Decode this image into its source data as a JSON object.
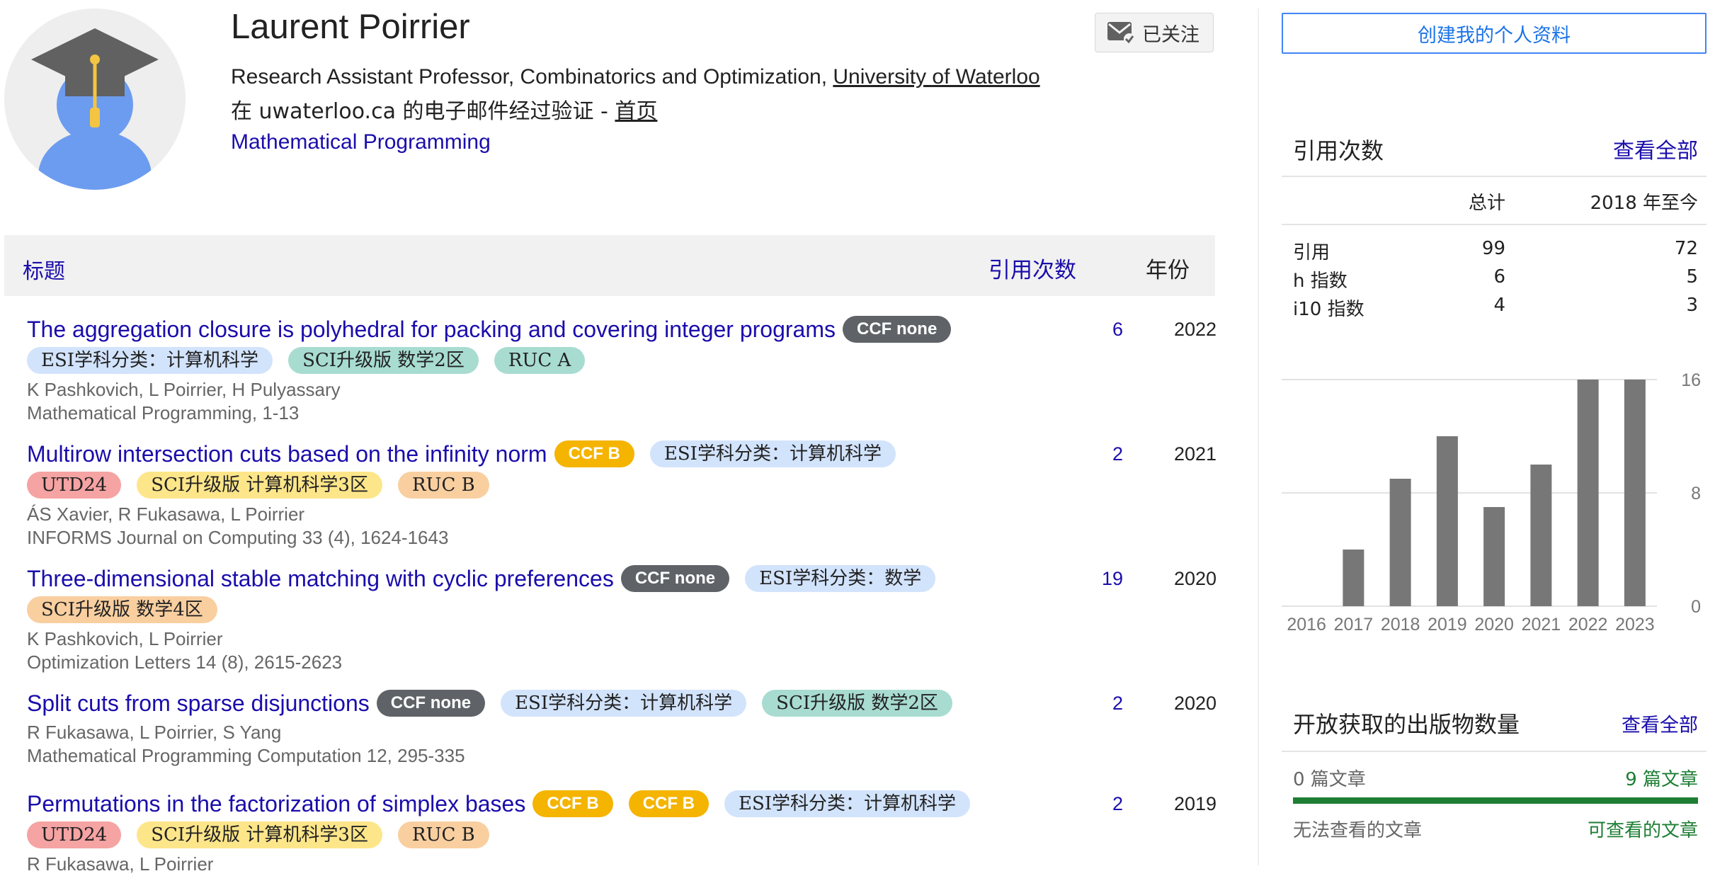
{
  "profile": {
    "name": "Laurent Poirrier",
    "affiliation_prefix": "Research Assistant Professor, Combinatorics and Optimization, ",
    "affiliation_link": "University of Waterloo",
    "email_text": "在 uwaterloo.ca 的电子邮件经过验证 - ",
    "homepage_link": "首页",
    "interest": "Mathematical Programming",
    "follow_label": "已关注"
  },
  "table": {
    "header_title": "标题",
    "header_cited": "引用次数",
    "header_year": "年份",
    "rows": [
      {
        "title": "The aggregation closure is polyhedral for packing and covering integer programs",
        "authors": "K Pashkovich, L Poirrier, H Pulyassary",
        "venue": "Mathematical Programming, 1-13",
        "cited": "6",
        "year": "2022",
        "tags_line1": [
          {
            "text": "CCF none",
            "kind": "ccf-none"
          }
        ],
        "tags_line2": [
          {
            "text": "ESI学科分类：计算机科学",
            "kind": "esi"
          },
          {
            "text": "SCI升级版 数学2区",
            "kind": "teal"
          },
          {
            "text": "RUC A",
            "kind": "teal"
          }
        ]
      },
      {
        "title": "Multirow intersection cuts based on the infinity norm",
        "authors": "ÁS Xavier, R Fukasawa, L Poirrier",
        "venue": "INFORMS Journal on Computing 33 (4), 1624-1643",
        "cited": "2",
        "year": "2021",
        "tags_line1": [
          {
            "text": "CCF B",
            "kind": "ccf-b"
          },
          {
            "text": "ESI学科分类：计算机科学",
            "kind": "esi"
          }
        ],
        "tags_line2": [
          {
            "text": "UTD24",
            "kind": "red"
          },
          {
            "text": "SCI升级版 计算机科学3区",
            "kind": "yellow"
          },
          {
            "text": "RUC B",
            "kind": "orange"
          }
        ]
      },
      {
        "title": "Three-dimensional stable matching with cyclic preferences",
        "authors": "K Pashkovich, L Poirrier",
        "venue": "Optimization Letters 14 (8), 2615-2623",
        "cited": "19",
        "year": "2020",
        "tags_line1": [
          {
            "text": "CCF none",
            "kind": "ccf-none"
          },
          {
            "text": "ESI学科分类：数学",
            "kind": "esi"
          }
        ],
        "tags_line2": [
          {
            "text": "SCI升级版 数学4区",
            "kind": "orange"
          }
        ]
      },
      {
        "title": "Split cuts from sparse disjunctions",
        "authors": "R Fukasawa, L Poirrier, S Yang",
        "venue": "Mathematical Programming Computation 12, 295-335",
        "cited": "2",
        "year": "2020",
        "tags_line1": [
          {
            "text": "CCF none",
            "kind": "ccf-none"
          },
          {
            "text": "ESI学科分类：计算机科学",
            "kind": "esi"
          },
          {
            "text": "SCI升级版 数学2区",
            "kind": "teal"
          }
        ],
        "tags_line2": []
      },
      {
        "title": "Permutations in the factorization of simplex bases",
        "authors": "R Fukasawa, L Poirrier",
        "venue": "",
        "cited": "2",
        "year": "2019",
        "tags_line1": [
          {
            "text": "CCF B",
            "kind": "ccf-b"
          },
          {
            "text": "CCF B",
            "kind": "ccf-b"
          },
          {
            "text": "ESI学科分类：计算机科学",
            "kind": "esi"
          }
        ],
        "tags_line2": [
          {
            "text": "UTD24",
            "kind": "red"
          },
          {
            "text": "SCI升级版 计算机科学3区",
            "kind": "yellow"
          },
          {
            "text": "RUC B",
            "kind": "orange"
          }
        ]
      }
    ]
  },
  "tag_colors": {
    "ccf-none": "#5f6368",
    "ccf-b": "#f4b400",
    "esi": "#d2e3fc",
    "teal": "#a8dcd1",
    "red": "#f5a3a3",
    "yellow": "#fde68a",
    "orange": "#f9cfa0"
  },
  "sidebar": {
    "create_profile": "创建我的个人资料",
    "cited_by_heading": "引用次数",
    "view_all": "查看全部",
    "col_total": "总计",
    "col_since": "2018 年至今",
    "stats": [
      {
        "label": "引用",
        "total": "99",
        "since": "72"
      },
      {
        "label": "h 指数",
        "total": "6",
        "since": "5"
      },
      {
        "label": "i10 指数",
        "total": "4",
        "since": "3"
      }
    ],
    "oa_heading": "开放获取的出版物数量",
    "oa_view_all": "查看全部",
    "oa_left_count": "0 篇文章",
    "oa_right_count": "9 篇文章",
    "oa_left_label": "无法查看的文章",
    "oa_right_label": "可查看的文章",
    "oa_bar_color": "#1e7e34"
  },
  "chart_data": {
    "type": "bar",
    "categories": [
      "2016",
      "2017",
      "2018",
      "2019",
      "2020",
      "2021",
      "2022",
      "2023"
    ],
    "values": [
      0,
      4,
      9,
      12,
      7,
      10,
      16,
      16
    ],
    "yticks": [
      "0",
      "8",
      "16"
    ],
    "ylim": [
      0,
      16
    ],
    "bar_color": "#777777"
  }
}
